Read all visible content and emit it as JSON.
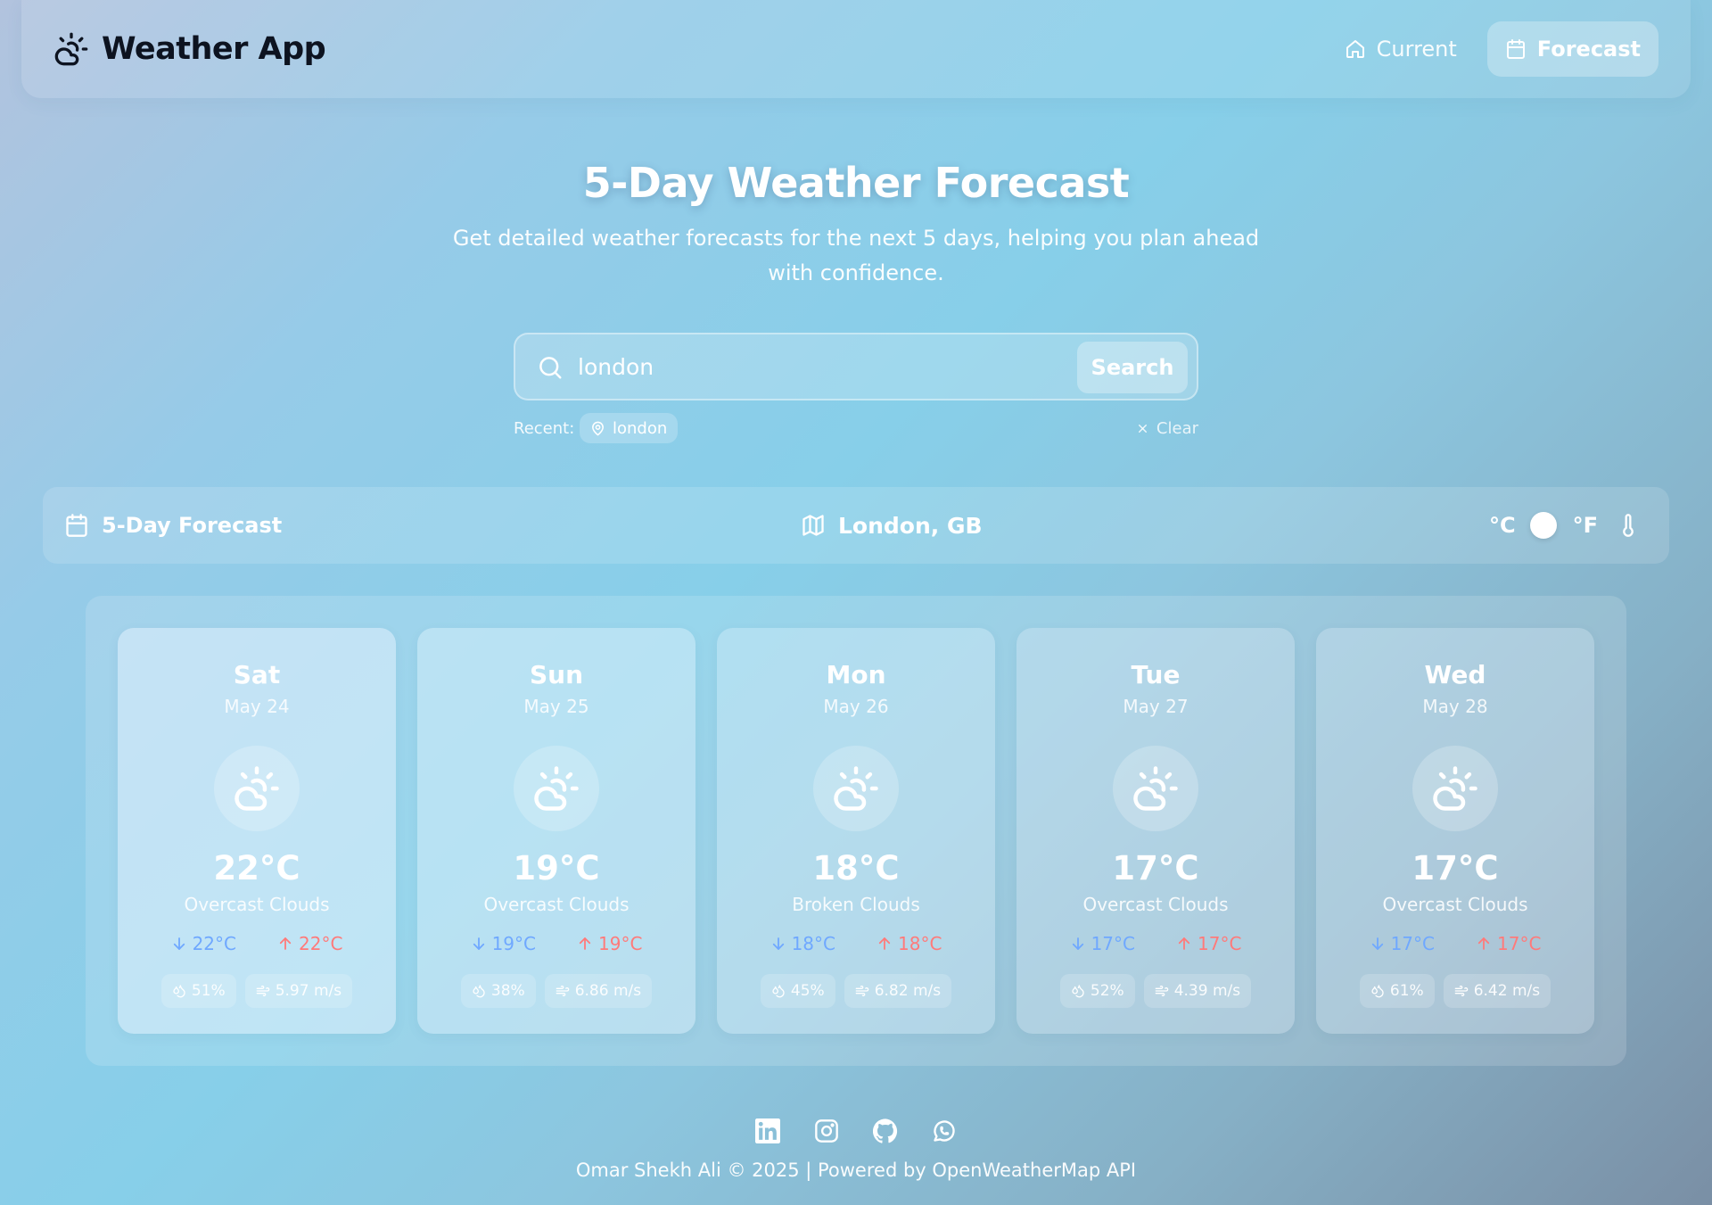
{
  "app": {
    "title": "Weather App"
  },
  "nav": [
    {
      "label": "Current",
      "icon": "home-icon",
      "active": false
    },
    {
      "label": "Forecast",
      "icon": "calendar-icon",
      "active": true
    }
  ],
  "hero": {
    "title": "5-Day Weather Forecast",
    "subtitle": "Get detailed weather forecasts for the next 5 days, helping you plan ahead with confidence."
  },
  "search": {
    "value": "london",
    "button_label": "Search",
    "recent_label": "Recent:",
    "recent": [
      "london"
    ],
    "clear_label": "Clear"
  },
  "forecast_bar": {
    "title": "5-Day Forecast",
    "location": "London, GB",
    "unit_c": "°C",
    "unit_f": "°F",
    "selected_unit": "C"
  },
  "days": [
    {
      "day": "Sat",
      "date": "May 24",
      "temp": "22°C",
      "desc": "Overcast Clouds",
      "min": "22°C",
      "max": "22°C",
      "humidity": "51%",
      "wind": "5.97 m/s",
      "icon": "partly-cloudy-icon"
    },
    {
      "day": "Sun",
      "date": "May 25",
      "temp": "19°C",
      "desc": "Overcast Clouds",
      "min": "19°C",
      "max": "19°C",
      "humidity": "38%",
      "wind": "6.86 m/s",
      "icon": "partly-cloudy-icon"
    },
    {
      "day": "Mon",
      "date": "May 26",
      "temp": "18°C",
      "desc": "Broken Clouds",
      "min": "18°C",
      "max": "18°C",
      "humidity": "45%",
      "wind": "6.82 m/s",
      "icon": "partly-cloudy-icon"
    },
    {
      "day": "Tue",
      "date": "May 27",
      "temp": "17°C",
      "desc": "Overcast Clouds",
      "min": "17°C",
      "max": "17°C",
      "humidity": "52%",
      "wind": "4.39 m/s",
      "icon": "partly-cloudy-icon"
    },
    {
      "day": "Wed",
      "date": "May 28",
      "temp": "17°C",
      "desc": "Overcast Clouds",
      "min": "17°C",
      "max": "17°C",
      "humidity": "61%",
      "wind": "6.42 m/s",
      "icon": "partly-cloudy-icon"
    }
  ],
  "footer": {
    "text": "Omar Shekh Ali © 2025 | Powered by OpenWeatherMap API",
    "social": [
      "linkedin-icon",
      "instagram-icon",
      "github-icon",
      "whatsapp-icon"
    ]
  },
  "colors": {
    "min_temp": "#6fa8ff",
    "max_temp": "#ff7a7a",
    "logo_text": "#0d1320"
  }
}
